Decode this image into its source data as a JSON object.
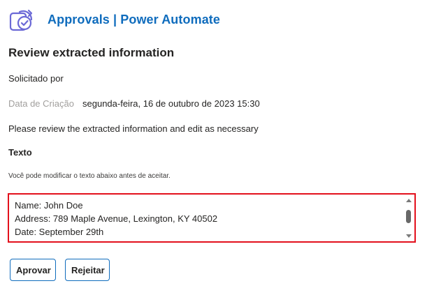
{
  "header": {
    "app_title": "Approvals | Power Automate",
    "icon": "approvals-icon",
    "accent_color": "#0f6cbd"
  },
  "card": {
    "title": "Review extracted information",
    "requested_by_label": "Solicitado por",
    "created_label": "Data de Criação",
    "created_value": "segunda-feira, 16 de outubro de 2023 15:30",
    "instructions": "Please review the extracted information and edit as necessary",
    "text_section_heading": "Texto",
    "text_hint": "Você pode modificar o texto abaixo antes de aceitar.",
    "text_value": "Name: John Doe\nAddress: 789 Maple Avenue, Lexington, KY 40502\nDate: September 29th",
    "highlight_color": "#e3101c"
  },
  "actions": {
    "approve_label": "Aprovar",
    "reject_label": "Rejeitar"
  }
}
